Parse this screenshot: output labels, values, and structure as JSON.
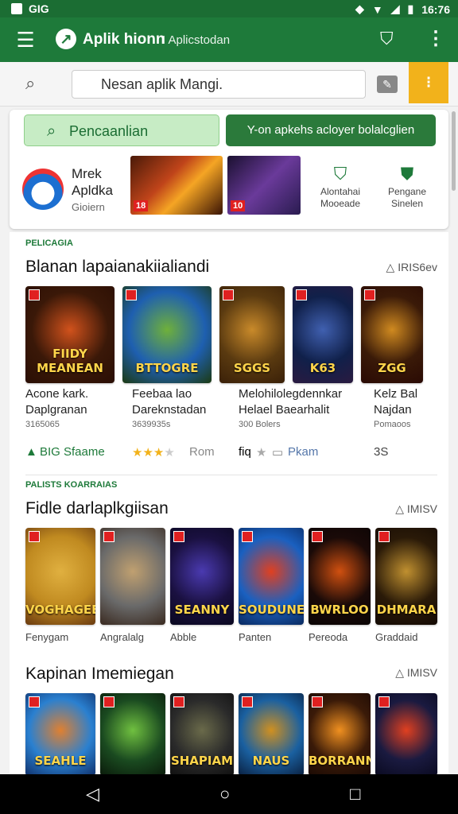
{
  "status": {
    "left_text": "GIG",
    "time": "16:76"
  },
  "appbar": {
    "title": "Aplik hionn",
    "subtitle": "I Aplicstodan"
  },
  "search": {
    "value": "Nesan aplik Mangi."
  },
  "card": {
    "pill_primary": "Pencaanlian",
    "pill_secondary": "Y-on apkehs acloyer bolalcglien",
    "profile": {
      "line1": "Mrek",
      "line2": "Apldka",
      "line3": "Gioiern"
    },
    "icon1": {
      "line1": "Alontahai",
      "line2": "Mooeade"
    },
    "icon2": {
      "line1": "Pengane",
      "line2": "Sinelen"
    }
  },
  "section1": {
    "tag": "PELICAGIA",
    "title": "Blanan lapaianakiialiandi",
    "more": "IRIS6ev",
    "games": [
      {
        "art": "FIIDY MEANEAN",
        "title1": "Acone kark.",
        "title2": "Daplgranan",
        "meta": "3165065",
        "colors": [
          "#3a1808",
          "#d1521c",
          "#2a0e04"
        ]
      },
      {
        "art": "BTTOGRE",
        "title1": "Feebaa lao",
        "title2": "Dareknstadan",
        "meta": "3639935s",
        "colors": [
          "#1e5fb0",
          "#6fb03a",
          "#1c3a12"
        ]
      },
      {
        "art": "SGGS",
        "title1": "Melohilolegdennkar",
        "title2": "Helael Baearhalit",
        "meta": "300 Bolers",
        "colors": [
          "#5a3a10",
          "#c98a2a",
          "#3a2008"
        ]
      },
      {
        "art": "K63",
        "title1": "Kelz Bal",
        "title2": "Najdan",
        "meta": "Pomaoos",
        "colors": [
          "#10204a",
          "#4060b0",
          "#2a1a40"
        ]
      },
      {
        "art": "ZGG",
        "title1": "",
        "title2": "",
        "meta": "",
        "colors": [
          "#3a1a08",
          "#d08a20",
          "#2a0a04"
        ]
      }
    ],
    "badge_text": "BIG Sfaame",
    "rating_label": "Rom",
    "price1": "fiq",
    "price2": "Pkam",
    "price3": "3S"
  },
  "section2": {
    "tag": "PALISTS KOARRAIAS",
    "title": "Fidle darlaplkgiisan",
    "more": "IMISV",
    "games": [
      {
        "art": "VOGHAGEE",
        "label": "Fenygam",
        "colors": [
          "#c08a20",
          "#e0b040",
          "#6a3a10"
        ]
      },
      {
        "art": "",
        "label": "Angralalg",
        "colors": [
          "#6a6a6a",
          "#c0a070",
          "#3a2a20"
        ]
      },
      {
        "art": "SEANNY",
        "label": "Abble",
        "colors": [
          "#1a1040",
          "#4a3ab0",
          "#0a0820"
        ]
      },
      {
        "art": "SOUDUNE",
        "label": "Panten",
        "colors": [
          "#1a60c0",
          "#e04020",
          "#0a2a60"
        ]
      },
      {
        "art": "BWRLOO",
        "label": "Pereoda",
        "colors": [
          "#1a0a08",
          "#d05010",
          "#0a0404"
        ]
      },
      {
        "art": "DHMARA",
        "label": "Graddaid",
        "colors": [
          "#2a1a08",
          "#c09030",
          "#140a04"
        ]
      }
    ]
  },
  "section3": {
    "title": "Kapinan Imemiegan",
    "more": "IMISV",
    "games": [
      {
        "art": "SEAHLE",
        "colors": [
          "#2a80d0",
          "#e08030",
          "#10306a"
        ]
      },
      {
        "art": "",
        "colors": [
          "#1a4a20",
          "#70c040",
          "#0a1a0a"
        ]
      },
      {
        "art": "SHAPIAM",
        "colors": [
          "#2a2a2a",
          "#6a6a4a",
          "#101010"
        ]
      },
      {
        "art": "NAUS",
        "colors": [
          "#1a60a0",
          "#d09020",
          "#0a2040"
        ]
      },
      {
        "art": "BORRANN",
        "colors": [
          "#3a1a08",
          "#f09020",
          "#1a0a04"
        ]
      },
      {
        "art": "",
        "colors": [
          "#1a1a40",
          "#e04020",
          "#0a0a20"
        ]
      }
    ]
  }
}
